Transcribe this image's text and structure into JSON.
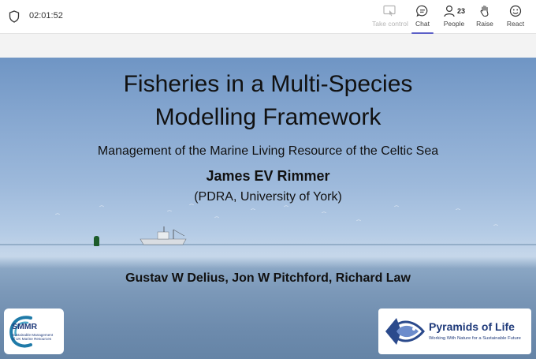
{
  "toolbar": {
    "timer": "02:01:52",
    "take_control_label": "Take control",
    "chat_label": "Chat",
    "people_label": "People",
    "people_count": "23",
    "raise_label": "Raise",
    "react_label": "React",
    "icons": [
      "shield-icon",
      "take-control-icon",
      "chat-icon",
      "people-icon",
      "raise-hand-icon",
      "react-icon"
    ],
    "accent_color": "#5b5fc7"
  },
  "slide": {
    "title_line1": "Fisheries in a Multi-Species",
    "title_line2": "Modelling Framework",
    "subtitle": "Management of the Marine Living Resource of the Celtic Sea",
    "presenter": "James EV Rimmer",
    "affiliation": "(PDRA, University of York)",
    "coauthors": "Gustav W Delius, Jon W Pitchford, Richard Law",
    "logo_left": {
      "name": "SMMR",
      "tagline_line1": "Sustainable Management",
      "tagline_line2": "of UK Marine Resources"
    },
    "logo_right": {
      "name": "Pyramids of Life",
      "tagline": "Working With Nature for a Sustainable Future"
    }
  }
}
